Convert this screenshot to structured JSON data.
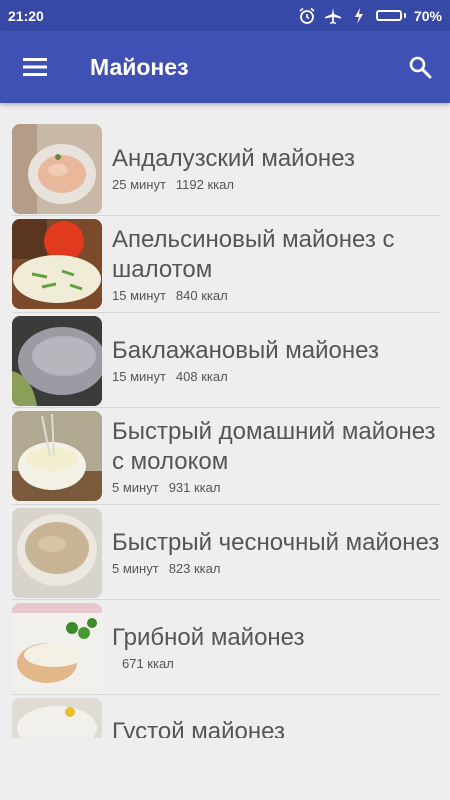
{
  "status": {
    "time": "21:20",
    "battery": "70%",
    "battery_level": 0.7,
    "icons": [
      "alarm-icon",
      "airplane-icon",
      "charging-icon"
    ]
  },
  "appbar": {
    "title": "Майонез",
    "menu_icon": "menu-icon",
    "search_icon": "search-icon"
  },
  "colors": {
    "statusbar": "#3748a6",
    "appbar": "#3f51b5",
    "background": "#eeeeee",
    "text": "#555555"
  },
  "recipes": [
    {
      "title": "Андалузский майонез",
      "time": "25 минут",
      "kcal": "1192 ккал"
    },
    {
      "title": "Апельсиновый майонез с шалотом",
      "time": "15 минут",
      "kcal": "840 ккал"
    },
    {
      "title": "Баклажановый майонез",
      "time": "15 минут",
      "kcal": "408 ккал"
    },
    {
      "title": "Быстрый домашний майонез с молоком",
      "time": "5 минут",
      "kcal": "931 ккал"
    },
    {
      "title": "Быстрый чесночный майонез",
      "time": "5 минут",
      "kcal": "823 ккал"
    },
    {
      "title": "Грибной майонез",
      "time": "",
      "kcal": "671 ккал"
    },
    {
      "title": "Густой майонез",
      "time": "",
      "kcal": ""
    }
  ]
}
